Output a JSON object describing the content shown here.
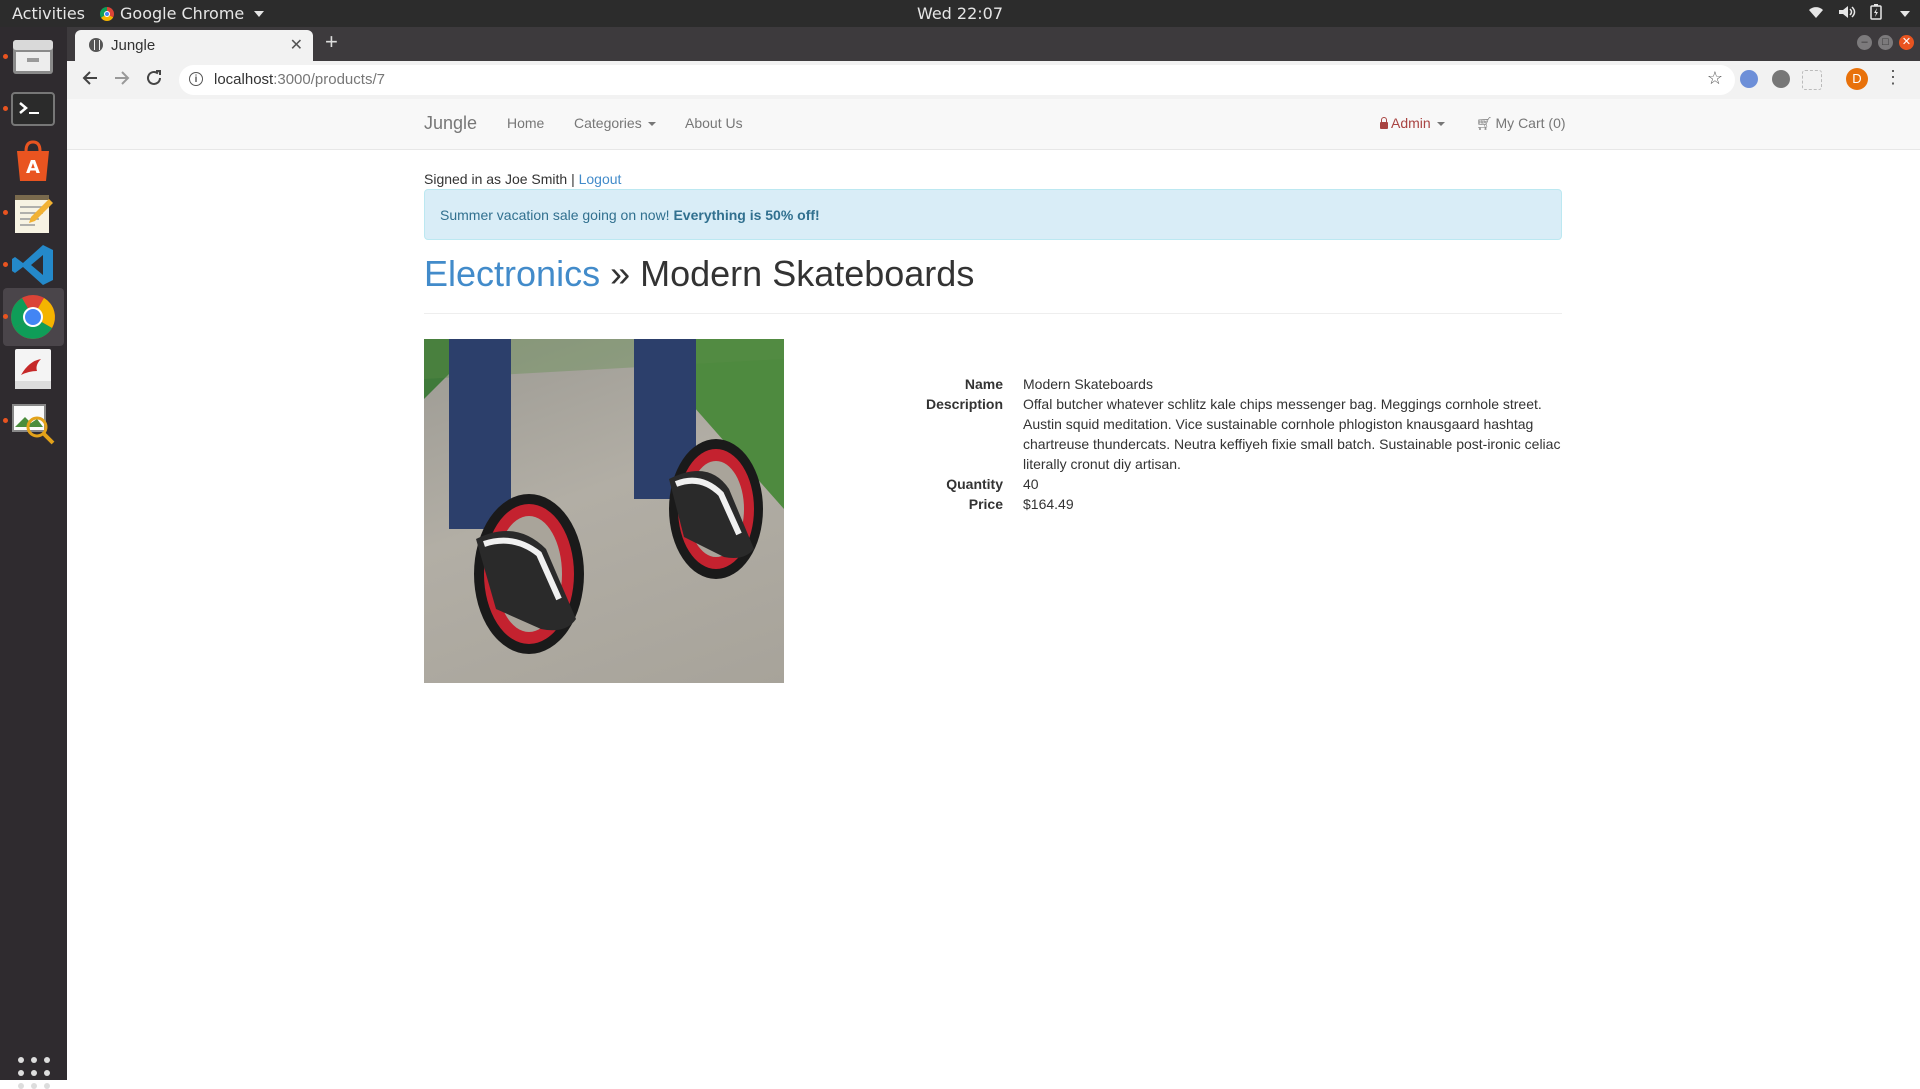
{
  "os": {
    "activities": "Activities",
    "app_name": "Google Chrome",
    "clock": "Wed 22:07"
  },
  "browser": {
    "tab_title": "Jungle",
    "url_host": "localhost",
    "url_rest": ":3000/products/7",
    "profile_initial": "D"
  },
  "navbar": {
    "brand": "Jungle",
    "home": "Home",
    "categories": "Categories",
    "about": "About Us",
    "admin": "Admin",
    "cart": "My Cart (0)"
  },
  "session": {
    "signed_in_text": "Signed in as Joe Smith |",
    "logout": "Logout"
  },
  "alert": {
    "text": "Summer vacation sale going on now!",
    "strong": "Everything is 50% off!"
  },
  "header": {
    "category": "Electronics",
    "separator": "»",
    "product": "Modern Skateboards"
  },
  "details": {
    "name_label": "Name",
    "name": "Modern Skateboards",
    "description_label": "Description",
    "description": "Offal butcher whatever schlitz kale chips messenger bag. Meggings cornhole street. Austin squid meditation. Vice sustainable cornhole phlogiston knausgaard hashtag chartreuse thundercats. Neutra keffiyeh fixie small batch. Sustainable post-ironic celiac literally cronut diy artisan.",
    "quantity_label": "Quantity",
    "quantity": "40",
    "price_label": "Price",
    "price": "$164.49"
  },
  "colors": {
    "link": "#428bca",
    "alert_bg": "#d9edf7",
    "alert_text": "#31708f",
    "admin": "#a94442"
  }
}
